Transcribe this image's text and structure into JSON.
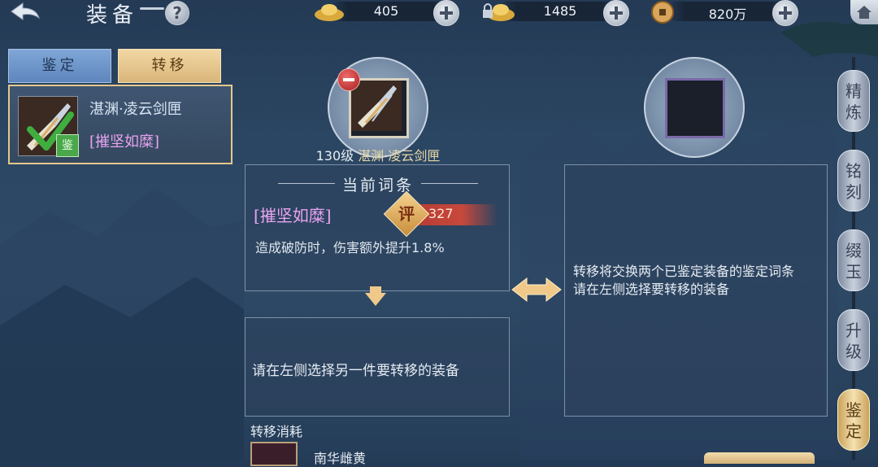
{
  "topbar": {
    "title": "装备",
    "help": "?",
    "currencies": [
      {
        "icon": "gold-ingot-icon",
        "value": "405"
      },
      {
        "icon": "bound-gold-ingot-icon",
        "value": "1485"
      },
      {
        "icon": "copper-coin-icon",
        "value": "820万"
      }
    ]
  },
  "tabs": {
    "identify": "鉴定",
    "transfer": "转移"
  },
  "equipment": {
    "name": "湛渊·凌云剑匣",
    "affix": "[摧坚如糜]",
    "badge": "鉴"
  },
  "slot_left": {
    "level": "130级",
    "name": "湛渊·凌云剑匣"
  },
  "current_affix": {
    "title": "当前词条",
    "affix_name": "[摧坚如糜]",
    "score_char": "评",
    "score": "327",
    "effect": "造成破防时，伤害额外提升1.8%"
  },
  "target_hint": "请在左侧选择另一件要转移的装备",
  "right_panel": {
    "line1": "转移将交换两个已鉴定装备的鉴定词条",
    "line2": "请在左侧选择要转移的装备"
  },
  "cost": {
    "label": "转移消耗",
    "item_name": "南华雌黄"
  },
  "side_tabs": [
    "精炼",
    "铭刻",
    "缀玉",
    "升级",
    "鉴定"
  ],
  "colors": {
    "affix": "#e7a3f0",
    "accent_gold": "#e6c88b",
    "score_red": "#c8483c"
  }
}
